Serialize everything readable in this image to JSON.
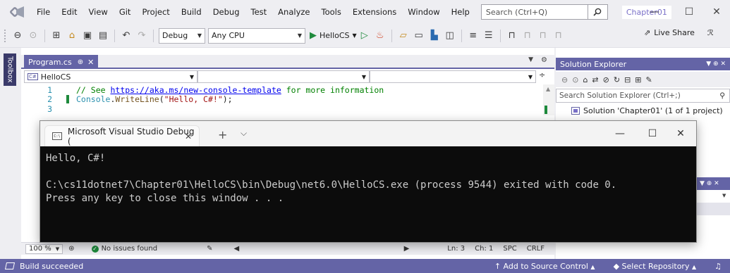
{
  "menu": {
    "items": [
      "File",
      "Edit",
      "View",
      "Git",
      "Project",
      "Build",
      "Debug",
      "Test",
      "Analyze",
      "Tools",
      "Extensions",
      "Window",
      "Help"
    ],
    "search_placeholder": "Search (Ctrl+Q)",
    "solution_name": "Chapter01"
  },
  "toolbar": {
    "config": "Debug",
    "platform": "Any CPU",
    "run_label": "HelloCS",
    "live_share": "Live Share"
  },
  "toolbox": {
    "label": "Toolbox"
  },
  "editor": {
    "tab_title": "Program.cs",
    "project_scope": "HelloCS",
    "lines": [
      {
        "num": "1",
        "comment_prefix": "// See ",
        "link": "https://aka.ms/new-console-template",
        "comment_suffix": " for more information"
      },
      {
        "num": "2",
        "ident": "Console",
        "dot": ".",
        "method": "WriteLine",
        "open": "(",
        "string": "\"Hello, C#!\"",
        "close": ");"
      },
      {
        "num": "3"
      }
    ],
    "status": {
      "zoom": "100 %",
      "issues": "No issues found",
      "line": "Ln: 3",
      "col": "Ch: 1",
      "spc": "SPC",
      "crlf": "CRLF"
    }
  },
  "solution_explorer": {
    "title": "Solution Explorer",
    "search_placeholder": "Search Solution Explorer (Ctrl+;)",
    "solution_item": "Solution 'Chapter01' (1 of 1 project)"
  },
  "console": {
    "title": "Microsoft Visual Studio Debug (",
    "output_line1": "Hello, C#!",
    "output_line2": "C:\\cs11dotnet7\\Chapter01\\HelloCS\\bin\\Debug\\net6.0\\HelloCS.exe (process 9544) exited with code 0.",
    "output_line3": "Press any key to close this window . . ."
  },
  "statusbar": {
    "build": "Build succeeded",
    "source_control": "Add to Source Control",
    "repository": "Select Repository"
  },
  "colors": {
    "accent": "#6464a6",
    "console_bg": "#0c0c0c",
    "change_bar": "#1e8a3c"
  }
}
